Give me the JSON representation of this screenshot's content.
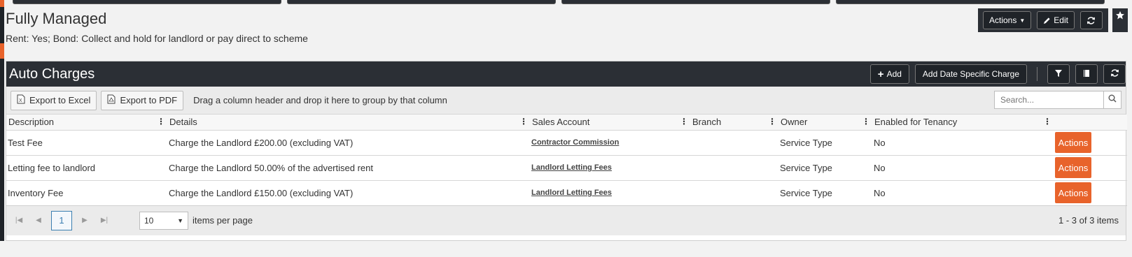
{
  "header": {
    "title": "Fully Managed",
    "subtitle": "Rent: Yes; Bond: Collect and hold for landlord or pay direct to scheme",
    "actions_label": "Actions",
    "edit_label": "Edit"
  },
  "panel": {
    "title": "Auto Charges",
    "add_label": "Add",
    "add_date_label": "Add Date Specific Charge"
  },
  "toolbar": {
    "export_excel": "Export to Excel",
    "export_pdf": "Export to PDF",
    "group_hint": "Drag a column header and drop it here to group by that column",
    "search_placeholder": "Search..."
  },
  "columns": [
    "Description",
    "Details",
    "Sales Account",
    "Branch",
    "Owner",
    "Enabled for Tenancy"
  ],
  "rows": [
    {
      "description": "Test Fee",
      "details": "Charge the Landlord £200.00 (excluding VAT)",
      "sales_account": "Contractor Commission",
      "branch": "",
      "owner": "Service Type",
      "enabled": "No",
      "action": "Actions"
    },
    {
      "description": "Letting fee to landlord",
      "details": "Charge the Landlord 50.00% of the advertised rent",
      "sales_account": "Landlord Letting Fees",
      "branch": "",
      "owner": "Service Type",
      "enabled": "No",
      "action": "Actions"
    },
    {
      "description": "Inventory Fee",
      "details": "Charge the Landlord £150.00 (excluding VAT)",
      "sales_account": "Landlord Letting Fees",
      "branch": "",
      "owner": "Service Type",
      "enabled": "No",
      "action": "Actions"
    }
  ],
  "pager": {
    "current_page": "1",
    "page_size": "10",
    "per_page_label": "items per page",
    "info": "1 - 3 of 3 items"
  },
  "colors": {
    "dark": "#2b2f35",
    "accent": "#e8632b",
    "link_blue": "#3c7fb1"
  }
}
